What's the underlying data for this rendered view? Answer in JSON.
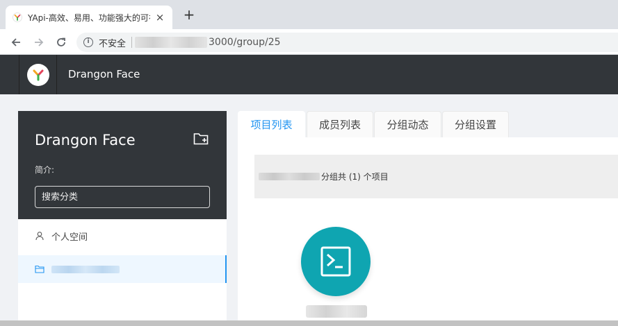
{
  "browser": {
    "tab_title": "YApi-高效、易用、功能强大的可视化接口管理平台",
    "tab_close": "×",
    "new_tab": "+",
    "security_label": "不安全",
    "url_visible": "3000/group/25"
  },
  "app": {
    "header_group_name": "Drangon Face"
  },
  "sidebar": {
    "group_title": "Drangon Face",
    "desc_label": "简介:",
    "search_placeholder": "搜索分类",
    "items": [
      {
        "label": "个人空间",
        "icon": "user-icon"
      },
      {
        "label": "",
        "icon": "folder-icon"
      }
    ]
  },
  "main": {
    "tabs": [
      {
        "label": "项目列表"
      },
      {
        "label": "成员列表"
      },
      {
        "label": "分组动态"
      },
      {
        "label": "分组设置"
      }
    ],
    "summary_text": "分组共 (1) 个项目",
    "project_icon": "terminal-icon"
  },
  "colors": {
    "header_bg": "#32363a",
    "accent": "#2395f1",
    "project_icon_bg": "#0fa5b1"
  }
}
